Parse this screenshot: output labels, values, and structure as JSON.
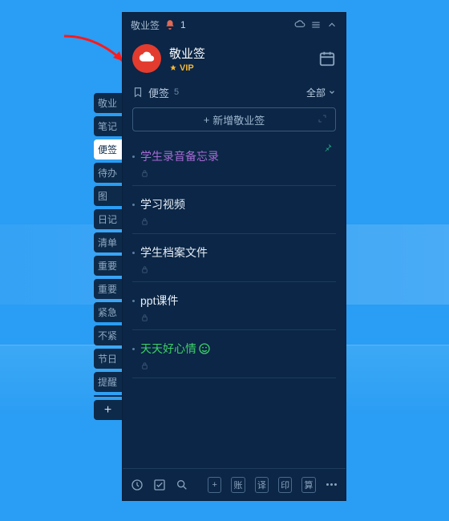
{
  "titlebar": {
    "app_name": "敬业签",
    "notif_count": "1"
  },
  "header": {
    "app_title": "敬业签",
    "vip_label": "VIP"
  },
  "category": {
    "label": "便签",
    "count": "5",
    "filter": "全部"
  },
  "add_button": {
    "label": "新增敬业签"
  },
  "sidetabs": [
    {
      "label": "敬业"
    },
    {
      "label": "笔记"
    },
    {
      "label": "便签"
    },
    {
      "label": "待办"
    },
    {
      "label": "图"
    },
    {
      "label": "日记"
    },
    {
      "label": "清单"
    },
    {
      "label": "重要"
    },
    {
      "label": "重要"
    },
    {
      "label": "紧急"
    },
    {
      "label": "不紧"
    },
    {
      "label": "节日"
    },
    {
      "label": "提醒"
    }
  ],
  "notes": [
    {
      "title": "学生录音备忘录",
      "color": "c-purple"
    },
    {
      "title": "学习视频",
      "color": "c-white"
    },
    {
      "title": "学生档案文件",
      "color": "c-white"
    },
    {
      "title": "ppt课件",
      "color": "c-white"
    },
    {
      "title": "天天好心情",
      "color": "c-green",
      "emoji": true
    }
  ],
  "bottombar": {
    "btn1": "账",
    "btn2": "译",
    "btn3": "印",
    "btn4": "算"
  }
}
